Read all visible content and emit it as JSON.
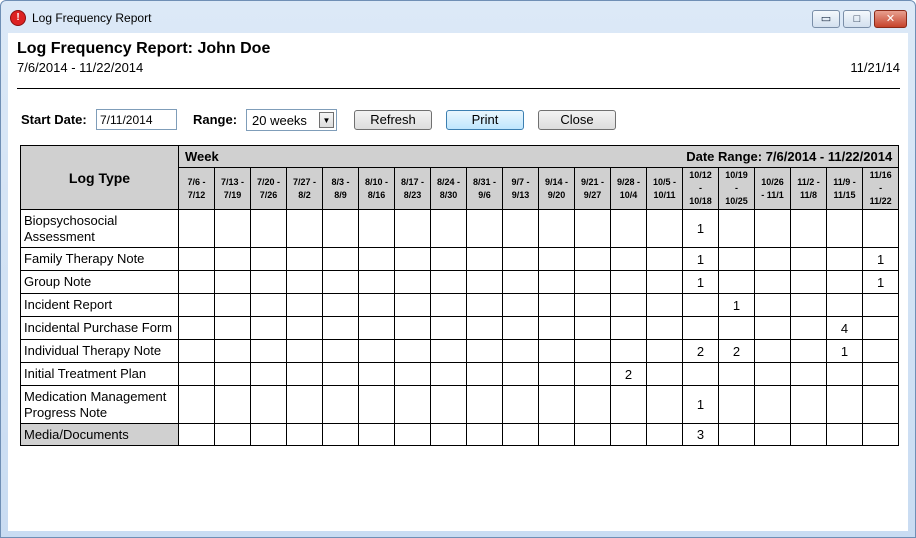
{
  "window": {
    "title": "Log Frequency Report",
    "controls": {
      "minimize": "▭",
      "maximize": "□",
      "close": "✕"
    }
  },
  "report": {
    "title": "Log Frequency Report: John Doe",
    "date_range": "7/6/2014 - 11/22/2014",
    "print_date": "11/21/14"
  },
  "controls": {
    "start_date_label": "Start Date:",
    "start_date_value": "7/11/2014",
    "range_label": "Range:",
    "range_value": "20 weeks",
    "refresh_label": "Refresh",
    "print_label": "Print",
    "close_label": "Close"
  },
  "grid": {
    "log_type_header": "Log Type",
    "week_header": "Week",
    "date_range_header": "Date Range: 7/6/2014 - 11/22/2014",
    "weeks": [
      [
        "7/6 -",
        "7/12"
      ],
      [
        "7/13 -",
        "7/19"
      ],
      [
        "7/20 -",
        "7/26"
      ],
      [
        "7/27 -",
        "8/2"
      ],
      [
        "8/3 -",
        "8/9"
      ],
      [
        "8/10 -",
        "8/16"
      ],
      [
        "8/17 -",
        "8/23"
      ],
      [
        "8/24 -",
        "8/30"
      ],
      [
        "8/31 -",
        "9/6"
      ],
      [
        "9/7 -",
        "9/13"
      ],
      [
        "9/14 -",
        "9/20"
      ],
      [
        "9/21 -",
        "9/27"
      ],
      [
        "9/28 -",
        "10/4"
      ],
      [
        "10/5 -",
        "10/11"
      ],
      [
        "10/12",
        "-",
        "10/18"
      ],
      [
        "10/19",
        "-",
        "10/25"
      ],
      [
        "10/26",
        "- 11/1"
      ],
      [
        "11/2 -",
        "11/8"
      ],
      [
        "11/9 -",
        "11/15"
      ],
      [
        "11/16",
        "-",
        "11/22"
      ]
    ],
    "rows": [
      {
        "label": "Biopsychosocial Assessment",
        "height": 38,
        "shaded": false,
        "counts": [
          "",
          "",
          "",
          "",
          "",
          "",
          "",
          "",
          "",
          "",
          "",
          "",
          "",
          "",
          "1",
          "",
          "",
          "",
          "",
          ""
        ]
      },
      {
        "label": "Family Therapy Note",
        "height": 23,
        "shaded": false,
        "counts": [
          "",
          "",
          "",
          "",
          "",
          "",
          "",
          "",
          "",
          "",
          "",
          "",
          "",
          "",
          "1",
          "",
          "",
          "",
          "",
          "1"
        ]
      },
      {
        "label": "Group Note",
        "height": 23,
        "shaded": false,
        "counts": [
          "",
          "",
          "",
          "",
          "",
          "",
          "",
          "",
          "",
          "",
          "",
          "",
          "",
          "",
          "1",
          "",
          "",
          "",
          "",
          "1"
        ]
      },
      {
        "label": "Incident Report",
        "height": 23,
        "shaded": false,
        "counts": [
          "",
          "",
          "",
          "",
          "",
          "",
          "",
          "",
          "",
          "",
          "",
          "",
          "",
          "",
          "",
          "1",
          "",
          "",
          "",
          ""
        ]
      },
      {
        "label": "Incidental Purchase Form",
        "height": 23,
        "shaded": false,
        "counts": [
          "",
          "",
          "",
          "",
          "",
          "",
          "",
          "",
          "",
          "",
          "",
          "",
          "",
          "",
          "",
          "",
          "",
          "",
          "4",
          ""
        ]
      },
      {
        "label": "Individual Therapy Note",
        "height": 23,
        "shaded": false,
        "counts": [
          "",
          "",
          "",
          "",
          "",
          "",
          "",
          "",
          "",
          "",
          "",
          "",
          "",
          "",
          "2",
          "2",
          "",
          "",
          "1",
          ""
        ]
      },
      {
        "label": "Initial Treatment Plan",
        "height": 23,
        "shaded": false,
        "counts": [
          "",
          "",
          "",
          "",
          "",
          "",
          "",
          "",
          "",
          "",
          "",
          "",
          "2",
          "",
          "",
          "",
          "",
          "",
          "",
          ""
        ]
      },
      {
        "label": "Medication Management Progress Note",
        "height": 38,
        "shaded": false,
        "counts": [
          "",
          "",
          "",
          "",
          "",
          "",
          "",
          "",
          "",
          "",
          "",
          "",
          "",
          "",
          "1",
          "",
          "",
          "",
          "",
          ""
        ]
      },
      {
        "label": "Media/Documents",
        "height": 22,
        "shaded": true,
        "counts": [
          "",
          "",
          "",
          "",
          "",
          "",
          "",
          "",
          "",
          "",
          "",
          "",
          "",
          "",
          "3",
          "",
          "",
          "",
          "",
          ""
        ]
      }
    ]
  }
}
